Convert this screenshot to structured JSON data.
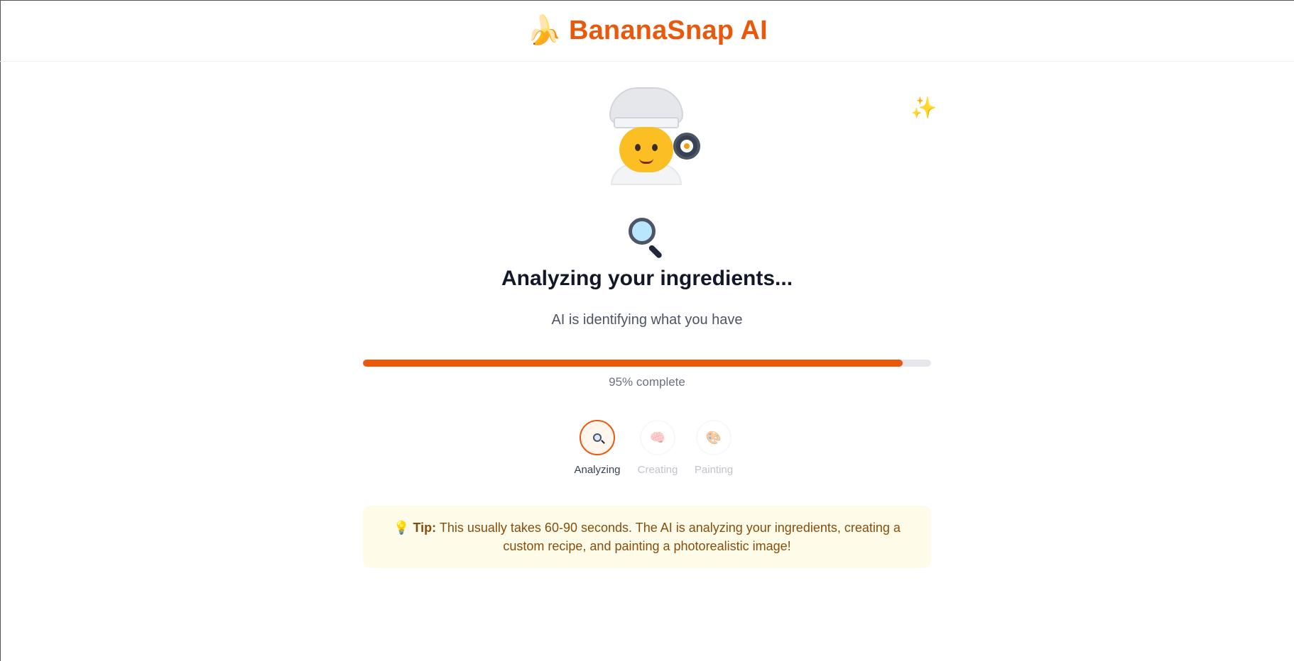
{
  "header": {
    "brand_icon": "🍌",
    "brand_name": "BananaSnap AI"
  },
  "decor": {
    "chef_icon": "chef-cooking-icon",
    "sparkles_icon": "✨"
  },
  "status": {
    "stage_icon": "magnifying-glass-icon",
    "title": "Analyzing your ingredients...",
    "subtitle": "AI is identifying what you have"
  },
  "progress": {
    "percent": 95,
    "text": "95% complete"
  },
  "steps": [
    {
      "label": "Analyzing",
      "icon": "magnifying-glass-icon",
      "state": "active"
    },
    {
      "label": "Creating",
      "icon": "🧠",
      "state": "inactive"
    },
    {
      "label": "Painting",
      "icon": "🎨",
      "state": "inactive"
    }
  ],
  "tip": {
    "icon": "💡",
    "label": "Tip:",
    "text": "This usually takes 60-90 seconds. The AI is analyzing your ingredients, creating a custom recipe, and painting a photorealistic image!"
  },
  "colors": {
    "accent": "#ea580c",
    "tip_bg": "#fefce8",
    "tip_text": "#854d0e"
  }
}
